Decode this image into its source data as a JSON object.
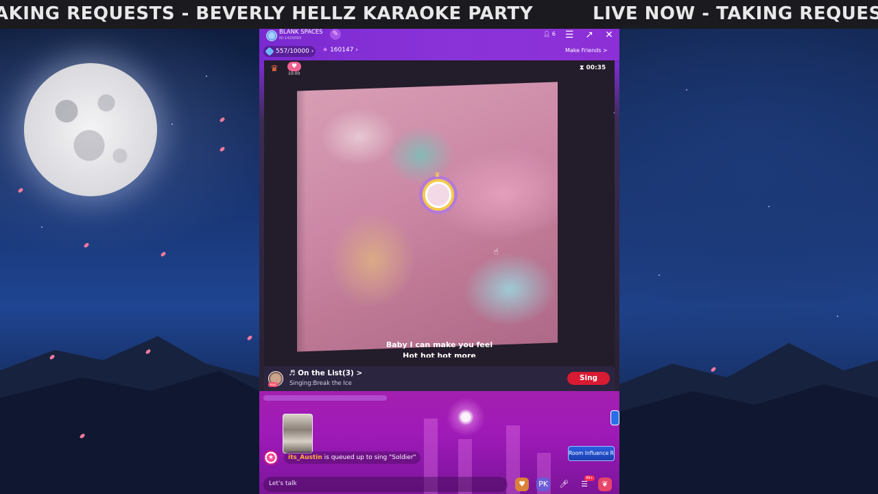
{
  "marquee": {
    "left_text": "AKING REQUESTS - BEVERLY HELLZ KARAOKE PARTY",
    "right_text": "LIVE NOW - TAKING REQUESTS"
  },
  "room": {
    "name": "BLANK SPACES",
    "id": "ID:1420093",
    "member_count": "6",
    "level_progress": "557/10000",
    "popularity": "160147",
    "make_friends": "Make Friends >"
  },
  "stage": {
    "heart_time": "10:00",
    "timer": "00:35",
    "lyric_current": "Baby I can make you feel",
    "lyric_next": "Hot hot hot more"
  },
  "song_list": {
    "title": "♬ On the List(3) >",
    "singing": "Singing:Break the Ice",
    "host_tag": "Host",
    "sing_button": "Sing"
  },
  "chat": {
    "queue_user": "its_Austin",
    "queue_text": " is queued up to sing \"Soldier\"",
    "influence_label": "Room Influence Ra"
  },
  "bottombar": {
    "input_placeholder": "Let's talk",
    "notif_badge": "99+"
  },
  "colors": {
    "accent_purple": "#8a33d9",
    "sing_red": "#d81b32",
    "username_orange": "#ffb13b"
  }
}
